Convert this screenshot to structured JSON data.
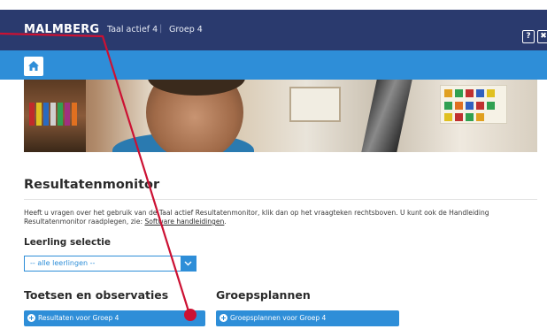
{
  "header": {
    "logo_text": "MALMBERG",
    "breadcrumb": [
      "Taal actief 4",
      "Groep 4"
    ],
    "separator": "|",
    "help_label": "?",
    "close_label": "✖"
  },
  "nav": {
    "home_icon": "home-icon"
  },
  "main": {
    "title": "Resultatenmonitor",
    "intro_text": "Heeft u vragen over het gebruik van de Taal actief Resultatenmonitor, klik dan op het vraagteken rechtsboven. U kunt ook de Handleiding Resultatenmonitor raadplegen, zie: ",
    "intro_link": "Software handleidingen",
    "intro_end": ".",
    "selection_label": "Leerling selectie",
    "selection_value": "-- alle leerlingen --",
    "section_tests": "Toetsen en observaties",
    "section_plans": "Groepsplannen",
    "btn_results": "Resultaten voor Groep 4",
    "btn_plans": "Groepsplannen voor Groep 4"
  },
  "colors": {
    "header_bg": "#2a3a6e",
    "nav_bg": "#2e8ed8",
    "accent": "#2e8ed8",
    "annotation": "#cc1133"
  }
}
